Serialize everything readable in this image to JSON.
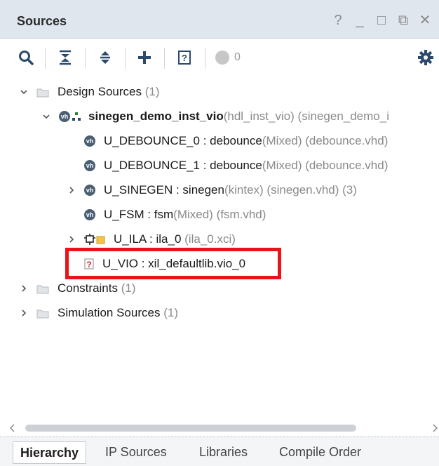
{
  "titlebar": {
    "title": "Sources",
    "buttons": [
      "?",
      "_",
      "□",
      "⧉",
      "✕"
    ]
  },
  "toolbar": {
    "icons": [
      "search-icon",
      "collapse-all-icon",
      "expand-all-icon",
      "add-icon",
      "hierarchy-update-icon",
      "status-circle-icon",
      "settings-gear-icon"
    ],
    "count": "0",
    "accent_color": "#2b4a6b"
  },
  "tree": {
    "design_sources": {
      "label": "Design Sources",
      "count": "(1)"
    },
    "top_module": {
      "name": "sinegen_demo_inst_vio",
      "extra": "(hdl_inst_vio) (sinegen_demo_i"
    },
    "debounce0": {
      "inst": "U_DEBOUNCE_0 : debounce",
      "meta": "(Mixed) (debounce.vhd)"
    },
    "debounce1": {
      "inst": "U_DEBOUNCE_1 : debounce",
      "meta": "(Mixed) (debounce.vhd)"
    },
    "sinegen": {
      "inst": "U_SINEGEN : sinegen",
      "meta": "(kintex) (sinegen.vhd) (3)"
    },
    "fsm": {
      "inst": "U_FSM : fsm",
      "meta": "(Mixed) (fsm.vhd)"
    },
    "ila": {
      "inst": "U_ILA : ila_0",
      "meta": "(ila_0.xci)"
    },
    "vio": {
      "inst": "U_VIO : xil_defaultlib.vio_0"
    },
    "constraints": {
      "label": "Constraints",
      "count": "(1)"
    },
    "simulation": {
      "label": "Simulation Sources",
      "count": "(1)"
    },
    "highlight_color": "#e8141a"
  },
  "tabs": [
    "Hierarchy",
    "IP Sources",
    "Libraries",
    "Compile Order"
  ]
}
